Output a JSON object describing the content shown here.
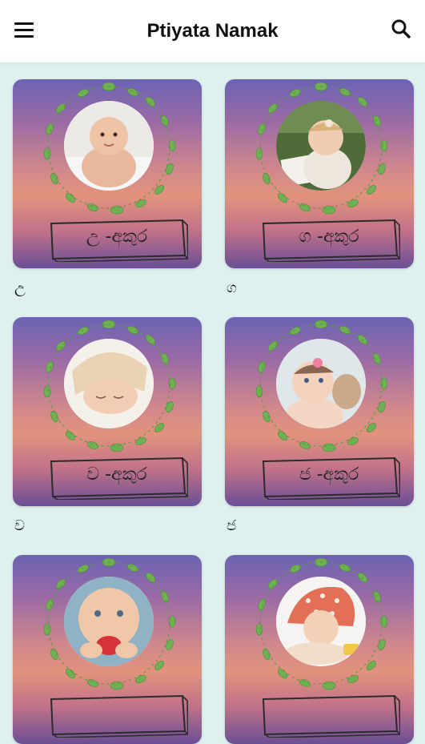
{
  "appbar": {
    "title": "Ptiyata Namak",
    "menu_icon": "menu-icon",
    "search_icon": "search-icon"
  },
  "colors": {
    "background": "#dff1ef",
    "appbar": "#ffffff",
    "leaf": "#6fb052"
  },
  "cards": [
    {
      "plate": "උ -අකුර",
      "caption": "උ",
      "photo": "baby-on-blanket"
    },
    {
      "plate": "ග -අකුර",
      "caption": "ග",
      "photo": "baby-with-book"
    },
    {
      "plate": "ව -අකුර",
      "caption": "ව",
      "photo": "sleeping-baby"
    },
    {
      "plate": "ජ -අකුර",
      "caption": "ජ",
      "photo": "baby-with-bow"
    },
    {
      "plate": "",
      "caption": "",
      "photo": "baby-chewing-toy"
    },
    {
      "plate": "",
      "caption": "",
      "photo": "baby-in-bonnet"
    }
  ]
}
